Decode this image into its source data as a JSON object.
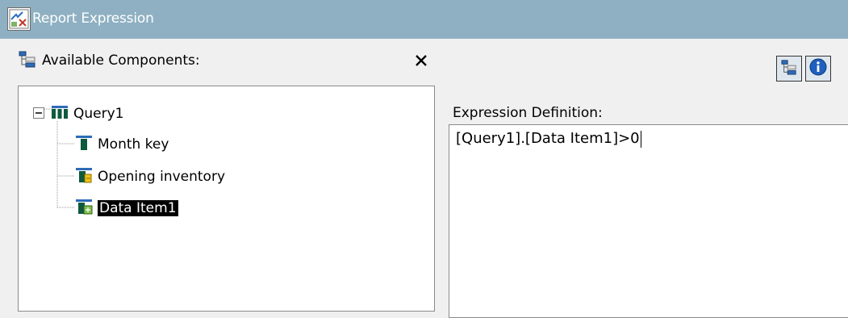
{
  "window": {
    "title": "Report Expression",
    "title_icon": "expression-editor-icon"
  },
  "left_pane": {
    "header_label": "Available Components:",
    "header_icon": "components-tree-icon",
    "close_icon": "close-icon",
    "tree": {
      "root": {
        "label": "Query1",
        "expanded": true,
        "icon": "query-icon"
      },
      "items": [
        {
          "label": "Month key",
          "icon": "data-item-icon",
          "selected": false
        },
        {
          "label": "Opening inventory",
          "icon": "measure-item-icon",
          "selected": false
        },
        {
          "label": "Data Item1",
          "icon": "calculated-item-icon",
          "selected": true
        }
      ]
    }
  },
  "right_pane": {
    "toolbar": [
      {
        "icon": "components-tree-icon"
      },
      {
        "icon": "info-icon"
      }
    ],
    "expression_label": "Expression Definition:",
    "expression_value": "[Query1].[Data Item1]>0"
  },
  "colors": {
    "titlebar": "#8eb0c2",
    "selection": "#000000",
    "panel_background": "#f0f0f0"
  }
}
